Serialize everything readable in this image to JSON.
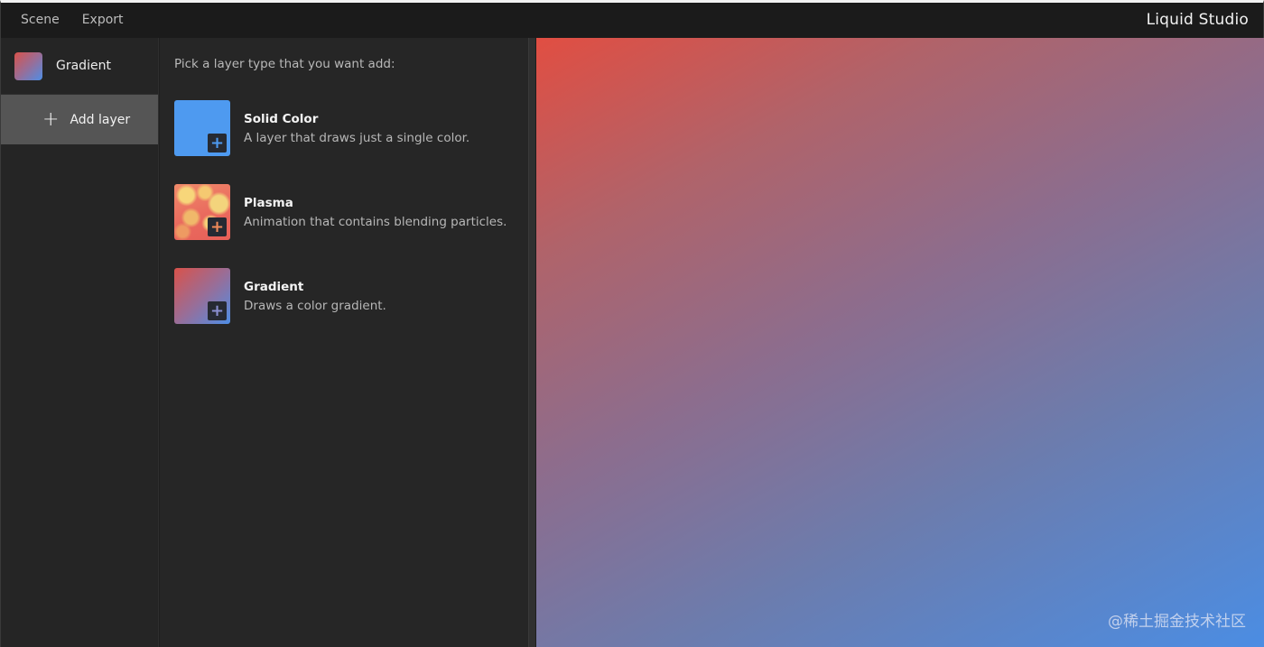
{
  "menu": {
    "items": [
      "Scene",
      "Export"
    ],
    "app_title": "Liquid Studio"
  },
  "layers": {
    "items": [
      {
        "name": "Gradient",
        "thumbnail": "gradient"
      }
    ],
    "add_button": {
      "icon": "plus-icon",
      "label": "Add layer"
    }
  },
  "picker": {
    "prompt": "Pick a layer type that you want add:",
    "options": [
      {
        "name": "Solid Color",
        "description": "A layer that draws just a single color.",
        "thumbnail": "solid",
        "plus_color": "#4e9af0"
      },
      {
        "name": "Plasma",
        "description": "Animation that contains blending particles.",
        "thumbnail": "plasma",
        "plus_color": "#f08a5a"
      },
      {
        "name": "Gradient",
        "description": "Draws a color gradient.",
        "thumbnail": "gradient",
        "plus_color": "#8a8fd0"
      }
    ]
  },
  "preview": {
    "gradient_colors": [
      "#e14e42",
      "#4b8de3"
    ],
    "watermark": "@稀土掘金技术社区"
  }
}
